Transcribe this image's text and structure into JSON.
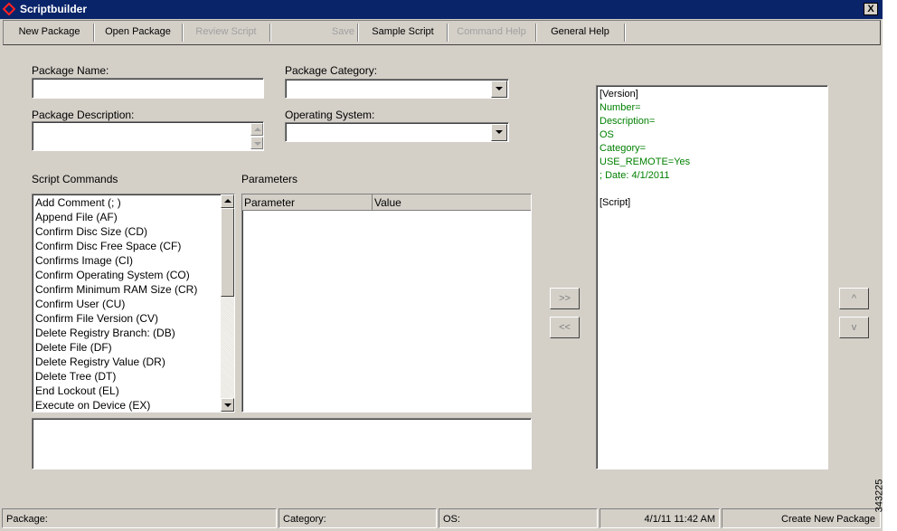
{
  "window": {
    "title": "Scriptbuilder",
    "close_label": "X"
  },
  "toolbar": {
    "new_package": "New Package",
    "open_package": "Open Package",
    "review_script": "Review Script",
    "save": "Save",
    "sample_script": "Sample Script",
    "command_help": "Command Help",
    "general_help": "General Help"
  },
  "form": {
    "package_name_label": "Package Name:",
    "package_name_value": "",
    "package_category_label": "Package Category:",
    "package_category_value": "",
    "package_description_label": "Package Description:",
    "package_description_value": "",
    "operating_system_label": "Operating System:",
    "operating_system_value": ""
  },
  "script_commands": {
    "label": "Script Commands",
    "items": [
      "Add Comment (; )",
      "Append File (AF)",
      "Confirm Disc Size (CD)",
      "Confirm Disc Free Space (CF)",
      "Confirms Image (CI)",
      "Confirm Operating System (CO)",
      "Confirm Minimum RAM Size (CR)",
      "Confirm User (CU)",
      "Confirm File Version (CV)",
      "Delete Registry Branch: (DB)",
      "Delete File (DF)",
      "Delete Registry Value (DR)",
      "Delete Tree (DT)",
      "End Lockout (EL)",
      "Execute on Device (EX)"
    ]
  },
  "parameters": {
    "label": "Parameters",
    "columns": [
      "Parameter",
      "Value"
    ]
  },
  "move_buttons": {
    "add": ">>",
    "remove": "<<"
  },
  "order_buttons": {
    "up": "^",
    "down": "v"
  },
  "script_preview": {
    "lines": [
      {
        "text": "[Version]",
        "color": "#000000"
      },
      {
        "text": "Number=",
        "color": "#008000"
      },
      {
        "text": "Description=",
        "color": "#008000"
      },
      {
        "text": "OS",
        "color": "#008000"
      },
      {
        "text": "Category=",
        "color": "#008000"
      },
      {
        "text": "USE_REMOTE=Yes",
        "color": "#008000"
      },
      {
        "text": "; Date: 4/1/2011",
        "color": "#008000"
      },
      {
        "text": "",
        "color": "#000000"
      },
      {
        "text": "[Script]",
        "color": "#000000"
      }
    ]
  },
  "status": {
    "package": "Package:",
    "category": "Category:",
    "os": "OS:",
    "datetime": "4/1/11 11:42 AM",
    "mode": "Create New Package"
  },
  "figure_id": "343225"
}
